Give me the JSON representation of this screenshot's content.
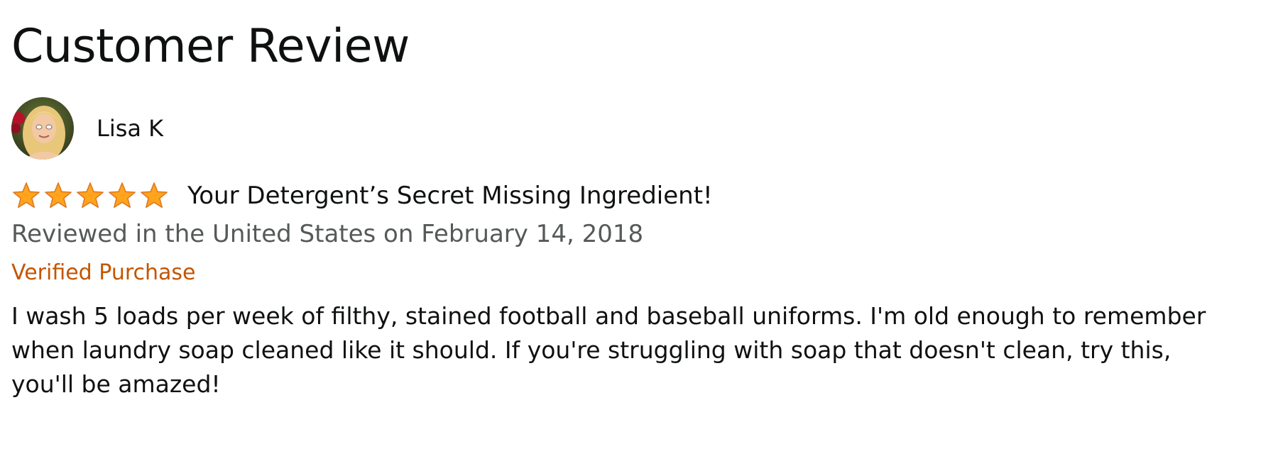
{
  "page": {
    "title": "Customer Review"
  },
  "reviewer": {
    "name": "Lisa K",
    "avatar_icon": "reviewer-photo"
  },
  "review": {
    "rating": 5,
    "rating_max": 5,
    "title": "Your Detergent’s Secret Missing Ingredient!",
    "date_line": "Reviewed in the United States on February 14, 2018",
    "verified_label": "Verified Purchase",
    "body_lines": [
      "I wash 5 loads per week of filthy, stained football and baseball uniforms. I'm old enough to remember",
      "when laundry soap cleaned like it should. If you're struggling with soap that doesn't clean, try this,",
      "you'll be amazed!"
    ]
  },
  "colors": {
    "star_fill": "#ffa41c",
    "star_stroke": "#de7921",
    "verified": "#c45500",
    "secondary_text": "#565959",
    "primary_text": "#0f1111"
  }
}
